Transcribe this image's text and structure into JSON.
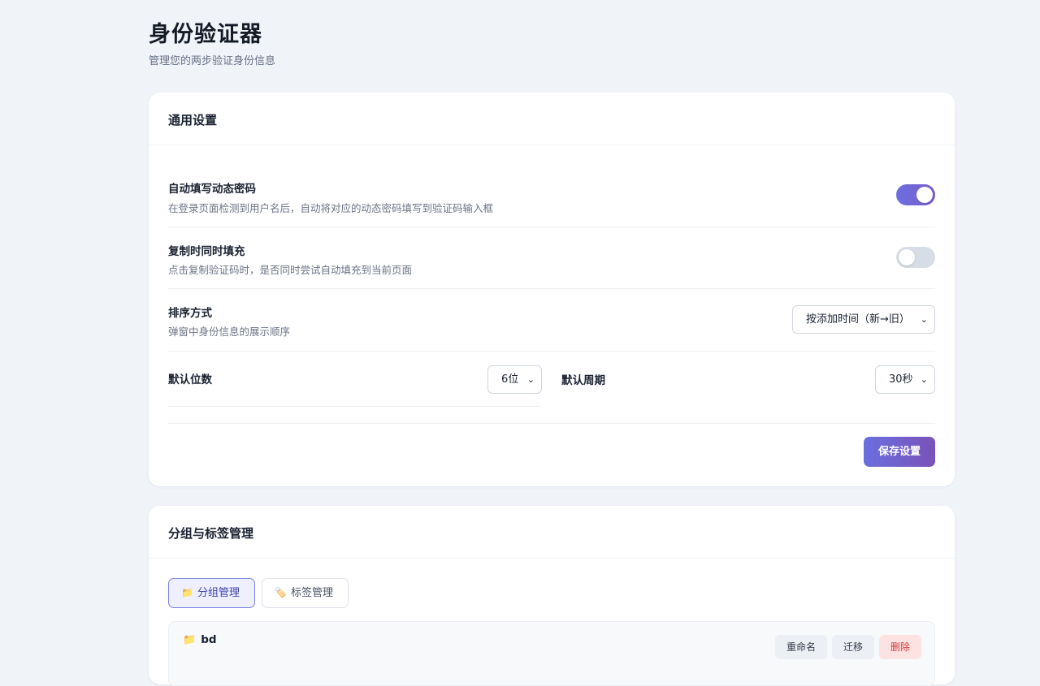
{
  "page": {
    "title": "身份验证器",
    "subtitle": "管理您的两步验证身份信息"
  },
  "general": {
    "heading": "通用设置",
    "autofill": {
      "title": "自动填写动态密码",
      "desc": "在登录页面检测到用户名后，自动将对应的动态密码填写到验证码输入框",
      "enabled": true
    },
    "copy_fill": {
      "title": "复制时同时填充",
      "desc": "点击复制验证码时，是否同时尝试自动填充到当前页面",
      "enabled": false
    },
    "sort": {
      "title": "排序方式",
      "desc": "弹窗中身份信息的展示顺序",
      "value": "按添加时间（新→旧）"
    },
    "digits": {
      "title": "默认位数",
      "value": "6位"
    },
    "period": {
      "title": "默认周期",
      "value": "30秒"
    },
    "save_label": "保存设置",
    "accent": "#6b6fe0"
  },
  "groups": {
    "heading": "分组与标签管理",
    "tabs": [
      {
        "label": "分组管理",
        "icon": "folder-icon",
        "active": true
      },
      {
        "label": "标签管理",
        "icon": "tag-icon",
        "active": false
      }
    ],
    "items": [
      {
        "name": "bd",
        "icon": "folder-icon",
        "actions": {
          "rename": "重命名",
          "move": "迁移",
          "delete": "删除"
        }
      }
    ]
  }
}
